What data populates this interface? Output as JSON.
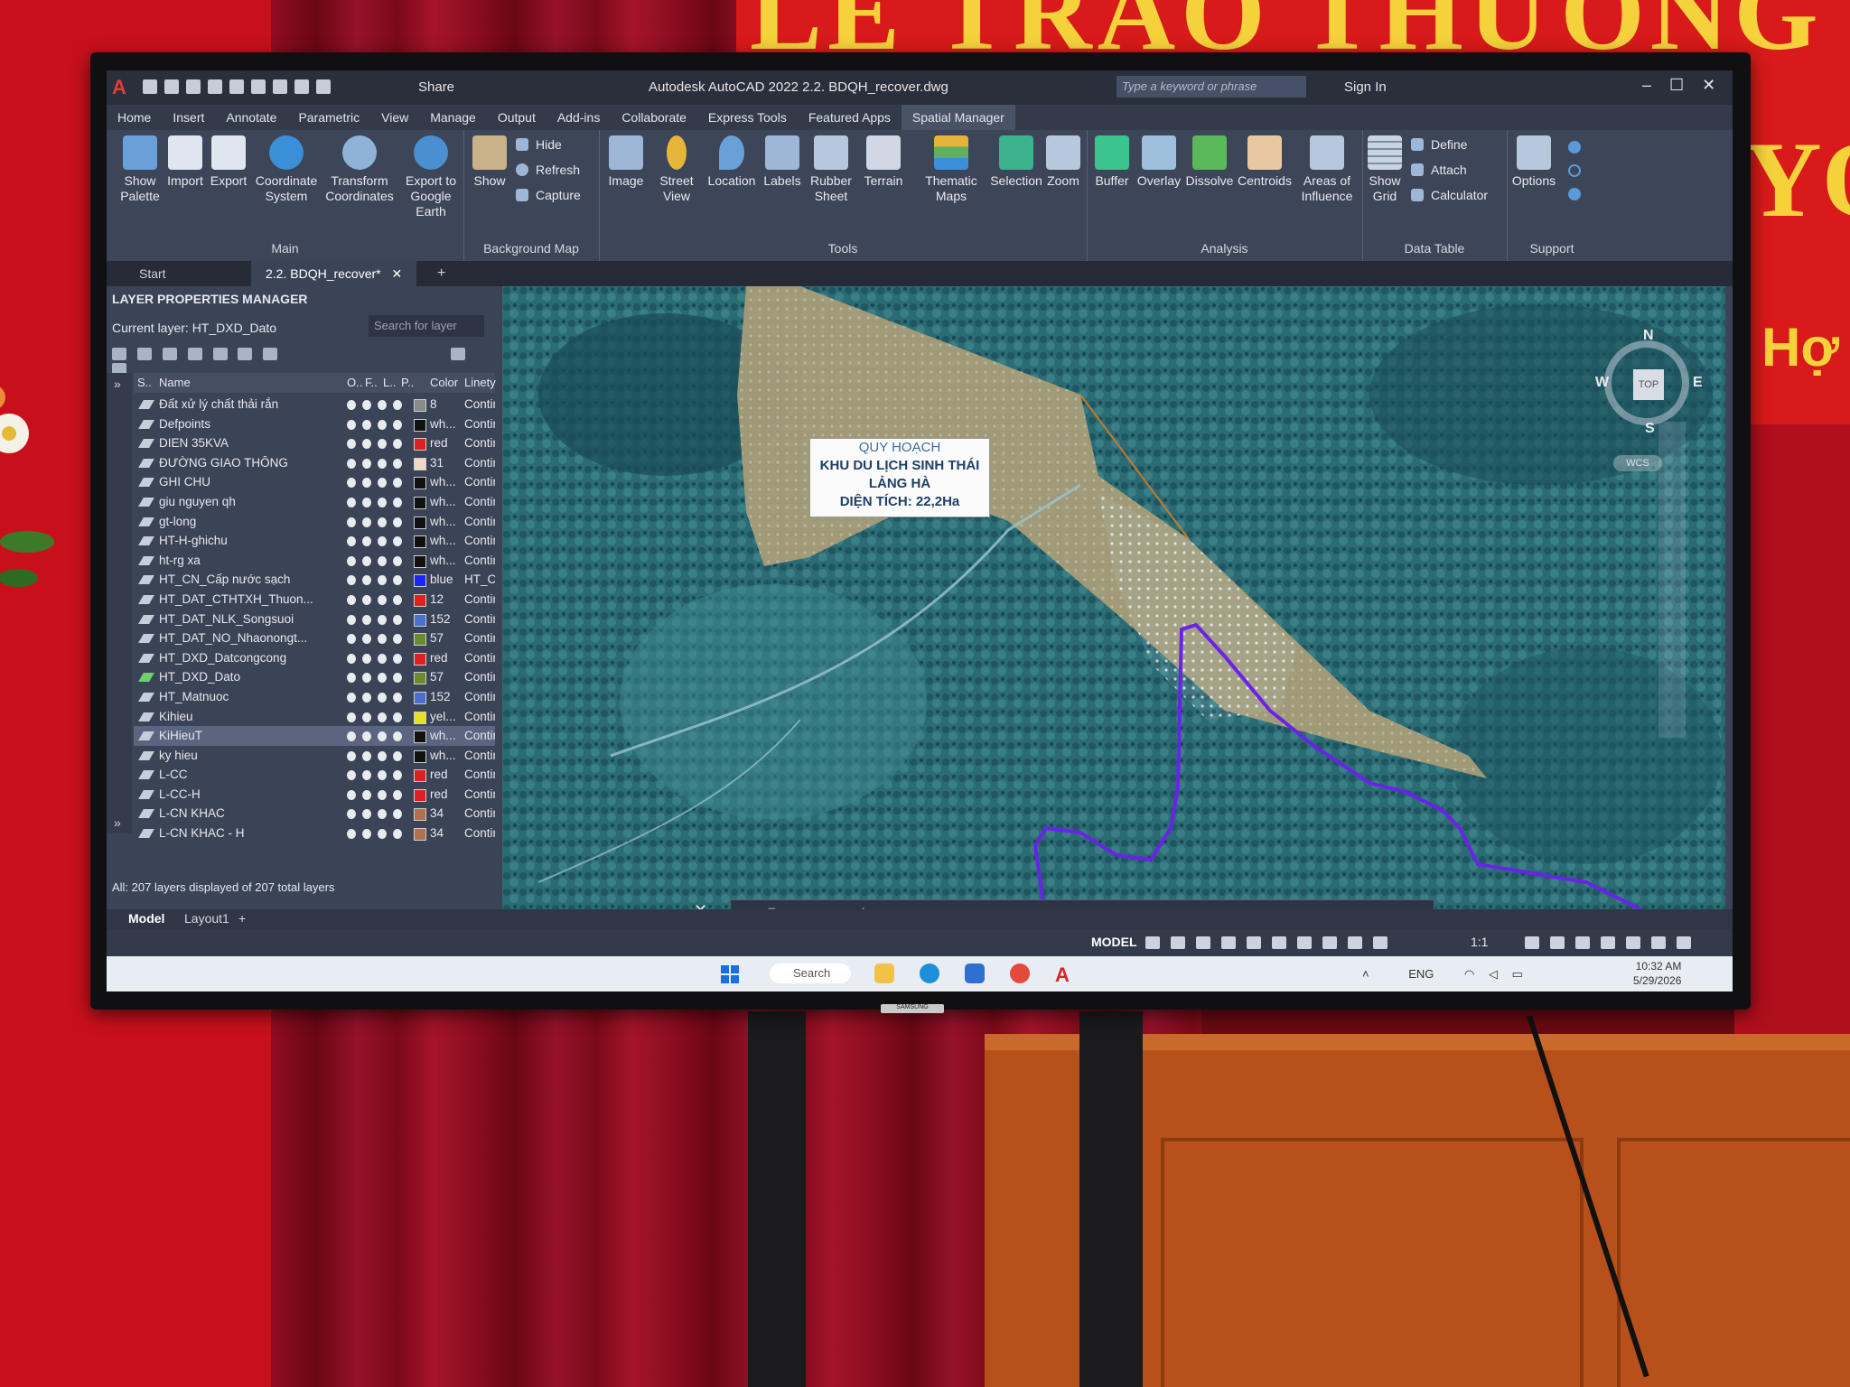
{
  "banner": {
    "line1": "LỄ TRAO THƯỞNG",
    "line2": "YO",
    "line3": "Hợ"
  },
  "monitor_brand": "SAMSUNG",
  "app": {
    "title": "Autodesk AutoCAD 2022   2.2. BDQH_recover.dwg",
    "share_label": "Share",
    "search_placeholder": "Type a keyword or phrase",
    "signin_label": "Sign In"
  },
  "menu": [
    "Home",
    "Insert",
    "Annotate",
    "Parametric",
    "View",
    "Manage",
    "Output",
    "Add-ins",
    "Collaborate",
    "Express Tools",
    "Featured Apps",
    "Spatial Manager"
  ],
  "ribbon": {
    "main": {
      "label": "Main",
      "buttons": [
        "Show Palette",
        "Import",
        "Export",
        "Coordinate System",
        "Transform Coordinates",
        "Export to Google Earth"
      ]
    },
    "background_map": {
      "label": "Background Map",
      "show": "Show",
      "hide": "Hide",
      "refresh": "Refresh",
      "capture": "Capture"
    },
    "tools": {
      "label": "Tools",
      "buttons": [
        "Image",
        "Street View",
        "Location",
        "Labels",
        "Rubber Sheet",
        "Terrain",
        "Thematic Maps",
        "Selection",
        "Zoom"
      ]
    },
    "analysis": {
      "label": "Analysis",
      "buttons": [
        "Buffer",
        "Overlay",
        "Dissolve",
        "Centroids",
        "Areas of Influence"
      ]
    },
    "data_table": {
      "label": "Data Table",
      "show_grid": "Show Grid",
      "define": "Define",
      "attach": "Attach",
      "calculator": "Calculator"
    },
    "support": {
      "label": "Support",
      "options": "Options"
    }
  },
  "file_tabs": [
    "Start",
    "2.2. BDQH_recover*"
  ],
  "palette": {
    "title": "LAYER PROPERTIES MANAGER",
    "current_layer": "Current layer: HT_DXD_Dato",
    "search_placeholder": "Search for layer",
    "columns": [
      "S..",
      "Name",
      "O..",
      "F..",
      "L..",
      "P..",
      "Color",
      "Linety"
    ],
    "layers": [
      {
        "name": "Đất xử lý chất thải rắn",
        "color": "8",
        "swatch": "#8a8a8a",
        "line": "Contin"
      },
      {
        "name": "Defpoints",
        "color": "wh...",
        "swatch": "#111111",
        "line": "Contin"
      },
      {
        "name": "DIEN 35KVA",
        "color": "red",
        "swatch": "#e02020",
        "line": "Contin"
      },
      {
        "name": "ĐƯỜNG GIAO THÔNG",
        "color": "31",
        "swatch": "#f0d8c8",
        "line": "Contin"
      },
      {
        "name": "GHI CHU",
        "color": "wh...",
        "swatch": "#111111",
        "line": "Contin"
      },
      {
        "name": "giu nguyen qh",
        "color": "wh...",
        "swatch": "#111111",
        "line": "Contin"
      },
      {
        "name": "gt-long",
        "color": "wh...",
        "swatch": "#111111",
        "line": "Contin"
      },
      {
        "name": "HT-H-ghichu",
        "color": "wh...",
        "swatch": "#111111",
        "line": "Contin"
      },
      {
        "name": "ht-rg xa",
        "color": "wh...",
        "swatch": "#111111",
        "line": "Contin"
      },
      {
        "name": "HT_CN_Cấp nước sạch",
        "color": "blue",
        "swatch": "#1a22ff",
        "line": "HT_CN"
      },
      {
        "name": "HT_DAT_CTHTXH_Thuon...",
        "color": "12",
        "swatch": "#e02020",
        "line": "Contin"
      },
      {
        "name": "HT_DAT_NLK_Songsuoi",
        "color": "152",
        "swatch": "#4a6fd0",
        "line": "Contin"
      },
      {
        "name": "HT_DAT_NO_Nhaonongt...",
        "color": "57",
        "swatch": "#6a8a30",
        "line": "Contin"
      },
      {
        "name": "HT_DXD_Datcongcong",
        "color": "red",
        "swatch": "#e02020",
        "line": "Contin"
      },
      {
        "name": "HT_DXD_Dato",
        "color": "57",
        "swatch": "#6a8a30",
        "line": "Contin"
      },
      {
        "name": "HT_Matnuoc",
        "color": "152",
        "swatch": "#4a6fd0",
        "line": "Contin"
      },
      {
        "name": "Kihieu",
        "color": "yel...",
        "swatch": "#e8e020",
        "line": "Contin"
      },
      {
        "name": "KiHieuT",
        "color": "wh...",
        "swatch": "#111111",
        "line": "Contin"
      },
      {
        "name": "ky hieu",
        "color": "wh...",
        "swatch": "#111111",
        "line": "Contin"
      },
      {
        "name": "L-CC",
        "color": "red",
        "swatch": "#e02020",
        "line": "Contin"
      },
      {
        "name": "L-CC-H",
        "color": "red",
        "swatch": "#e02020",
        "line": "Contin"
      },
      {
        "name": "L-CN KHAC",
        "color": "34",
        "swatch": "#b07050",
        "line": "Contin"
      },
      {
        "name": "L-CN KHAC - H",
        "color": "34",
        "swatch": "#b07050",
        "line": "Contin"
      }
    ],
    "current_index": 14,
    "selected_index": 17,
    "status": "All: 207 layers displayed of 207 total layers"
  },
  "map": {
    "label_lines": [
      "QUY HOẠCH",
      "KHU DU LỊCH SINH THÁI",
      "LẢNG HÀ",
      "DIỆN TÍCH: 22,2Ha"
    ],
    "viewcube": {
      "n": "N",
      "s": "S",
      "e": "E",
      "w": "W",
      "top": "TOP",
      "wcs": "WCS"
    },
    "command_placeholder": "Type a command"
  },
  "layout_tabs": [
    "Model",
    "Layout1"
  ],
  "status": {
    "model": "MODEL",
    "scale": "1:1"
  },
  "taskbar": {
    "search": "Search",
    "lang": "ENG",
    "time": "10:32 AM",
    "date": "5/29/2026"
  },
  "colors": {
    "accent": "#4a5266",
    "zone_fill": "#a89a72",
    "boundary": "#6a22e8"
  }
}
